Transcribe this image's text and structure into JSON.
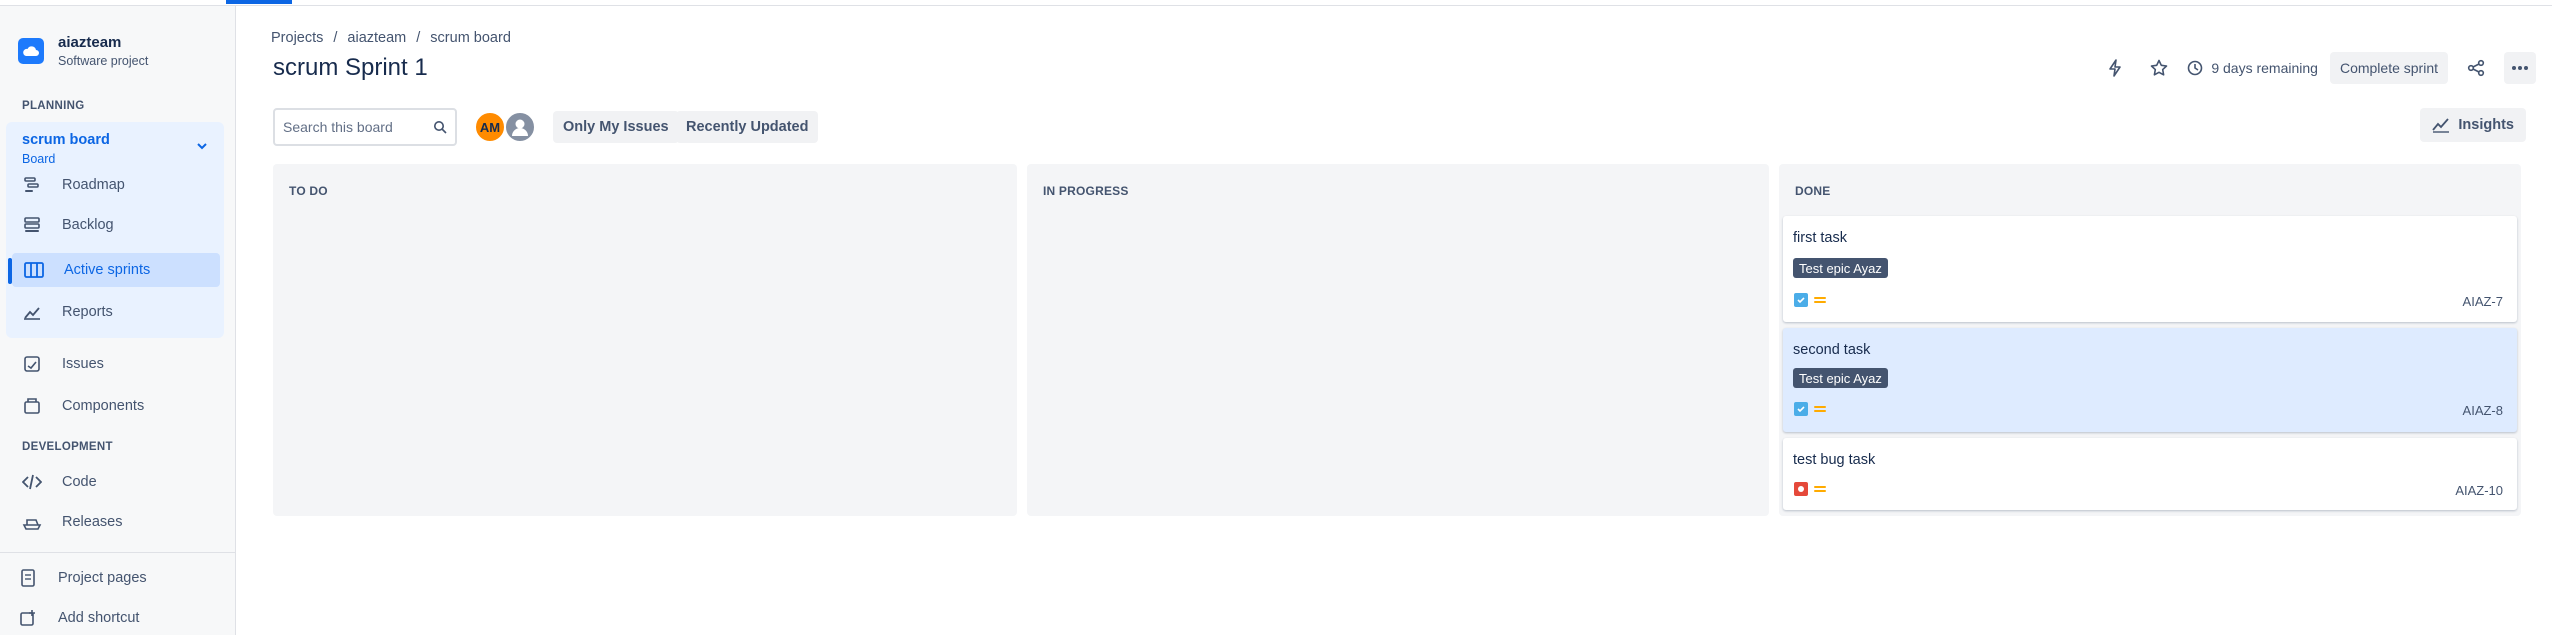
{
  "project": {
    "name": "aiazteam",
    "type": "Software project"
  },
  "sidebar": {
    "planning_label": "PLANNING",
    "board": {
      "title": "scrum board",
      "subtitle": "Board"
    },
    "board_items": [
      {
        "label": "Roadmap",
        "icon": "roadmap-icon"
      },
      {
        "label": "Backlog",
        "icon": "backlog-icon"
      },
      {
        "label": "Active sprints",
        "icon": "board-icon"
      },
      {
        "label": "Reports",
        "icon": "reports-icon"
      }
    ],
    "other_items": [
      {
        "label": "Issues",
        "icon": "issues-icon"
      },
      {
        "label": "Components",
        "icon": "components-icon"
      }
    ],
    "development_label": "DEVELOPMENT",
    "dev_items": [
      {
        "label": "Code",
        "icon": "code-icon"
      },
      {
        "label": "Releases",
        "icon": "releases-icon"
      }
    ],
    "footer_items": [
      {
        "label": "Project pages",
        "icon": "pages-icon"
      },
      {
        "label": "Add shortcut",
        "icon": "add-shortcut-icon"
      }
    ]
  },
  "breadcrumb": [
    "Projects",
    "/",
    "aiazteam",
    "/",
    "scrum board"
  ],
  "header": {
    "title": "scrum Sprint 1",
    "remaining": "9 days remaining",
    "complete_sprint": "Complete sprint"
  },
  "toolbar": {
    "search_placeholder": "Search this board",
    "avatar_initials": "AM",
    "only_my_issues": "Only My Issues",
    "recently_updated": "Recently Updated",
    "insights": "Insights"
  },
  "columns": [
    {
      "title": "TO DO"
    },
    {
      "title": "IN PROGRESS"
    },
    {
      "title": "DONE",
      "cards": [
        {
          "title": "first task",
          "epic": "Test epic Ayaz",
          "type": "task",
          "key": "AIAZ-7"
        },
        {
          "title": "second task",
          "epic": "Test epic Ayaz",
          "type": "task",
          "key": "AIAZ-8"
        },
        {
          "title": "test bug task",
          "epic": "",
          "type": "bug",
          "key": "AIAZ-10"
        }
      ]
    }
  ],
  "colors": {
    "accent": "#0c66e4",
    "task": "#4bade8",
    "bug": "#e5493a",
    "priority": "#ffab00"
  }
}
